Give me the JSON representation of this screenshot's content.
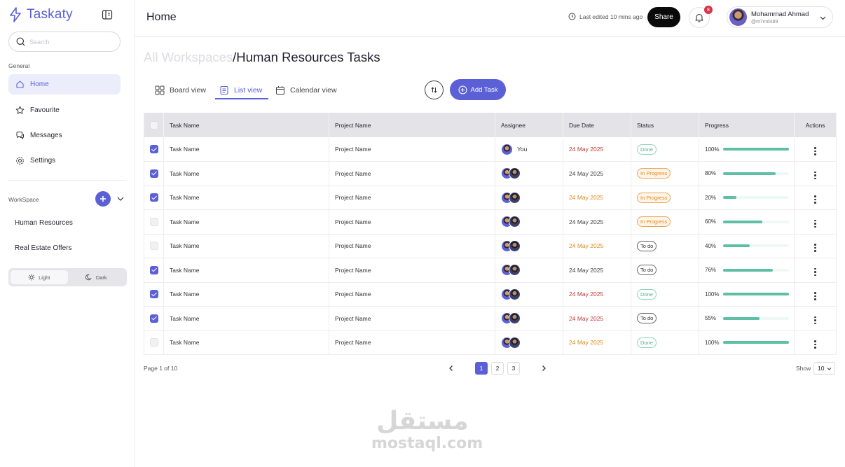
{
  "app": {
    "name": "Taskaty",
    "accent": "#5b60d6"
  },
  "sidebar": {
    "search_placeholder": "Search",
    "general_label": "General",
    "nav": [
      {
        "label": "Home",
        "icon": "home-icon",
        "active": true
      },
      {
        "label": "Favourite",
        "icon": "star-icon",
        "active": false
      },
      {
        "label": "Messages",
        "icon": "chat-icon",
        "active": false
      },
      {
        "label": "Settings",
        "icon": "gear-icon",
        "active": false
      }
    ],
    "workspace_label": "WorkSpace",
    "workspaces": [
      "Human Resources",
      "Real Estate Offers"
    ],
    "theme": {
      "light": "Light",
      "dark": "Dark",
      "selected": "Light"
    }
  },
  "topbar": {
    "title": "Home",
    "last_edited": "Last edited 10 mins ago",
    "share": "Share",
    "notifications": "8",
    "user_name": "Mohammad Ahmad",
    "user_handle": "@m7md489"
  },
  "breadcrumb": {
    "parent": "All Workspaces",
    "current": "/Human Resources Tasks"
  },
  "views": [
    {
      "label": "Board view",
      "icon": "grid-icon",
      "active": false
    },
    {
      "label": "List view",
      "icon": "list-icon",
      "active": true
    },
    {
      "label": "Calendar view",
      "icon": "calendar-icon",
      "active": false
    }
  ],
  "add_task": "Add Task",
  "table": {
    "columns": [
      "Task Name",
      "Project Name",
      "Assignee",
      "Due Date",
      "Status",
      "Progress",
      "Actions"
    ],
    "rows": [
      {
        "checked": true,
        "task": "Task Name",
        "project": "Project Name",
        "assignee": "You",
        "due": "24 May 2025",
        "due_color": "red",
        "status": "Done",
        "status_type": "done",
        "progress": "100%",
        "progress_value": 100
      },
      {
        "checked": true,
        "task": "Task Name",
        "project": "Project Name",
        "assignee": "",
        "due": "24 May 2025",
        "due_color": "gray",
        "status": "In Progress",
        "status_type": "prog",
        "progress": "80%",
        "progress_value": 80
      },
      {
        "checked": true,
        "task": "Task Name",
        "project": "Project Name",
        "assignee": "",
        "due": "24 May 2025",
        "due_color": "orange",
        "status": "In Progress",
        "status_type": "prog",
        "progress": "20%",
        "progress_value": 20
      },
      {
        "checked": false,
        "task": "Task Name",
        "project": "Project Name",
        "assignee": "",
        "due": "24 May 2025",
        "due_color": "gray",
        "status": "In Progress",
        "status_type": "prog",
        "progress": "60%",
        "progress_value": 60
      },
      {
        "checked": false,
        "task": "Task Name",
        "project": "Project Name",
        "assignee": "",
        "due": "24 May 2025",
        "due_color": "orange",
        "status": "To do",
        "status_type": "todo",
        "progress": "40%",
        "progress_value": 40
      },
      {
        "checked": true,
        "task": "Task Name",
        "project": "Project Name",
        "assignee": "",
        "due": "24 May 2025",
        "due_color": "gray",
        "status": "To do",
        "status_type": "todo",
        "progress": "76%",
        "progress_value": 76
      },
      {
        "checked": true,
        "task": "Task Name",
        "project": "Project Name",
        "assignee": "",
        "due": "24 May 2025",
        "due_color": "red",
        "status": "Done",
        "status_type": "done",
        "progress": "100%",
        "progress_value": 100
      },
      {
        "checked": true,
        "task": "Task Name",
        "project": "Project Name",
        "assignee": "",
        "due": "24 May 2025",
        "due_color": "red",
        "status": "To do",
        "status_type": "todo",
        "progress": "55%",
        "progress_value": 55
      },
      {
        "checked": false,
        "task": "Task Name",
        "project": "Project Name",
        "assignee": "",
        "due": "24 May 2025",
        "due_color": "orange",
        "status": "Done",
        "status_type": "done",
        "progress": "100%",
        "progress_value": 100
      }
    ]
  },
  "pagination": {
    "info": "Page 1 of 10",
    "pages": [
      "1",
      "2",
      "3"
    ],
    "current": "1",
    "show_label": "Show",
    "show_value": "10"
  },
  "watermark": {
    "arabic": "مستقل",
    "latin": "mostaql.com"
  }
}
